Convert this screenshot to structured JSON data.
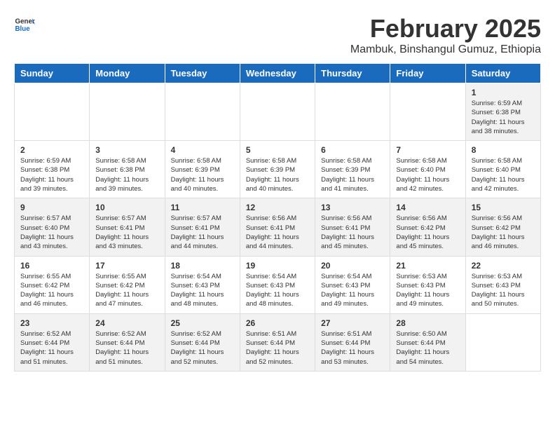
{
  "logo": {
    "text_general": "General",
    "text_blue": "Blue"
  },
  "title": "February 2025",
  "subtitle": "Mambuk, Binshangul Gumuz, Ethiopia",
  "days_of_week": [
    "Sunday",
    "Monday",
    "Tuesday",
    "Wednesday",
    "Thursday",
    "Friday",
    "Saturday"
  ],
  "weeks": [
    [
      {
        "day": "",
        "content": ""
      },
      {
        "day": "",
        "content": ""
      },
      {
        "day": "",
        "content": ""
      },
      {
        "day": "",
        "content": ""
      },
      {
        "day": "",
        "content": ""
      },
      {
        "day": "",
        "content": ""
      },
      {
        "day": "1",
        "content": "Sunrise: 6:59 AM\nSunset: 6:38 PM\nDaylight: 11 hours and 38 minutes."
      }
    ],
    [
      {
        "day": "2",
        "content": "Sunrise: 6:59 AM\nSunset: 6:38 PM\nDaylight: 11 hours and 39 minutes."
      },
      {
        "day": "3",
        "content": "Sunrise: 6:58 AM\nSunset: 6:38 PM\nDaylight: 11 hours and 39 minutes."
      },
      {
        "day": "4",
        "content": "Sunrise: 6:58 AM\nSunset: 6:39 PM\nDaylight: 11 hours and 40 minutes."
      },
      {
        "day": "5",
        "content": "Sunrise: 6:58 AM\nSunset: 6:39 PM\nDaylight: 11 hours and 40 minutes."
      },
      {
        "day": "6",
        "content": "Sunrise: 6:58 AM\nSunset: 6:39 PM\nDaylight: 11 hours and 41 minutes."
      },
      {
        "day": "7",
        "content": "Sunrise: 6:58 AM\nSunset: 6:40 PM\nDaylight: 11 hours and 42 minutes."
      },
      {
        "day": "8",
        "content": "Sunrise: 6:58 AM\nSunset: 6:40 PM\nDaylight: 11 hours and 42 minutes."
      }
    ],
    [
      {
        "day": "9",
        "content": "Sunrise: 6:57 AM\nSunset: 6:40 PM\nDaylight: 11 hours and 43 minutes."
      },
      {
        "day": "10",
        "content": "Sunrise: 6:57 AM\nSunset: 6:41 PM\nDaylight: 11 hours and 43 minutes."
      },
      {
        "day": "11",
        "content": "Sunrise: 6:57 AM\nSunset: 6:41 PM\nDaylight: 11 hours and 44 minutes."
      },
      {
        "day": "12",
        "content": "Sunrise: 6:56 AM\nSunset: 6:41 PM\nDaylight: 11 hours and 44 minutes."
      },
      {
        "day": "13",
        "content": "Sunrise: 6:56 AM\nSunset: 6:41 PM\nDaylight: 11 hours and 45 minutes."
      },
      {
        "day": "14",
        "content": "Sunrise: 6:56 AM\nSunset: 6:42 PM\nDaylight: 11 hours and 45 minutes."
      },
      {
        "day": "15",
        "content": "Sunrise: 6:56 AM\nSunset: 6:42 PM\nDaylight: 11 hours and 46 minutes."
      }
    ],
    [
      {
        "day": "16",
        "content": "Sunrise: 6:55 AM\nSunset: 6:42 PM\nDaylight: 11 hours and 46 minutes."
      },
      {
        "day": "17",
        "content": "Sunrise: 6:55 AM\nSunset: 6:42 PM\nDaylight: 11 hours and 47 minutes."
      },
      {
        "day": "18",
        "content": "Sunrise: 6:54 AM\nSunset: 6:43 PM\nDaylight: 11 hours and 48 minutes."
      },
      {
        "day": "19",
        "content": "Sunrise: 6:54 AM\nSunset: 6:43 PM\nDaylight: 11 hours and 48 minutes."
      },
      {
        "day": "20",
        "content": "Sunrise: 6:54 AM\nSunset: 6:43 PM\nDaylight: 11 hours and 49 minutes."
      },
      {
        "day": "21",
        "content": "Sunrise: 6:53 AM\nSunset: 6:43 PM\nDaylight: 11 hours and 49 minutes."
      },
      {
        "day": "22",
        "content": "Sunrise: 6:53 AM\nSunset: 6:43 PM\nDaylight: 11 hours and 50 minutes."
      }
    ],
    [
      {
        "day": "23",
        "content": "Sunrise: 6:52 AM\nSunset: 6:44 PM\nDaylight: 11 hours and 51 minutes."
      },
      {
        "day": "24",
        "content": "Sunrise: 6:52 AM\nSunset: 6:44 PM\nDaylight: 11 hours and 51 minutes."
      },
      {
        "day": "25",
        "content": "Sunrise: 6:52 AM\nSunset: 6:44 PM\nDaylight: 11 hours and 52 minutes."
      },
      {
        "day": "26",
        "content": "Sunrise: 6:51 AM\nSunset: 6:44 PM\nDaylight: 11 hours and 52 minutes."
      },
      {
        "day": "27",
        "content": "Sunrise: 6:51 AM\nSunset: 6:44 PM\nDaylight: 11 hours and 53 minutes."
      },
      {
        "day": "28",
        "content": "Sunrise: 6:50 AM\nSunset: 6:44 PM\nDaylight: 11 hours and 54 minutes."
      },
      {
        "day": "",
        "content": ""
      }
    ]
  ]
}
